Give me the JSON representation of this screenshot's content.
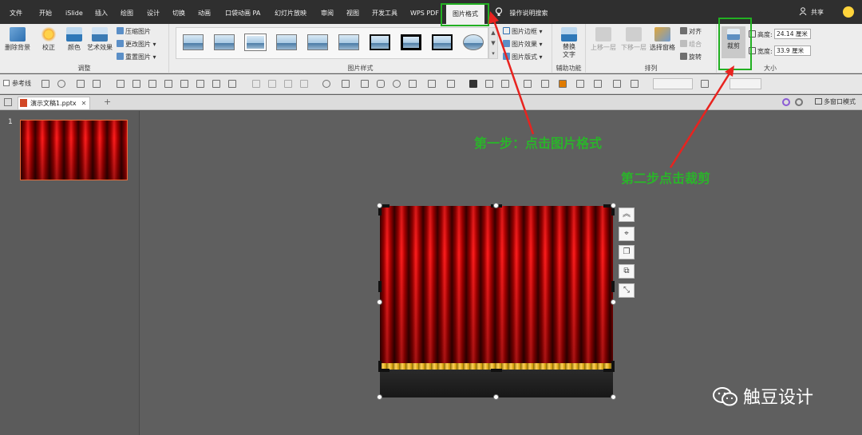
{
  "ribbon_tabs": {
    "file": "文件",
    "home": "开始",
    "islide": "iSlide",
    "insert": "插入",
    "draw": "绘图",
    "design": "设计",
    "transitions": "切换",
    "animations": "动画",
    "pocket_anim": "口袋动画 PA",
    "slideshow": "幻灯片放映",
    "review": "审阅",
    "view": "视图",
    "developer": "开发工具",
    "wps_pdf": "WPS PDF",
    "picture_format": "图片格式"
  },
  "tell_me": "操作说明搜索",
  "share": "共享",
  "ribbon": {
    "adjust": {
      "remove_bg": "删除背景",
      "corrections": "校正",
      "color": "颜色",
      "artistic": "艺术效果",
      "compress": "压缩图片",
      "change": "更改图片",
      "reset": "重置图片",
      "label": "调整"
    },
    "styles": {
      "label": "图片样式",
      "border": "图片边框",
      "effects": "图片效果",
      "layout": "图片版式"
    },
    "accessibility": {
      "alt_text": "替换文字",
      "label": "辅助功能"
    },
    "arrange": {
      "bring_forward": "上移一层",
      "send_backward": "下移一层",
      "selection_pane": "选择窗格",
      "align": "对齐",
      "group": "组合",
      "rotate": "旋转",
      "label": "排列"
    },
    "size": {
      "crop": "裁剪",
      "height_label": "高度:",
      "height_value": "24.14 厘米",
      "width_label": "宽度:",
      "width_value": "33.9 厘米",
      "label": "大小"
    }
  },
  "qat": {
    "guides": "参考线"
  },
  "document": {
    "tab_name": "演示文稿1.pptx",
    "multi_window": "多窗口模式"
  },
  "slides": {
    "number": "1"
  },
  "annotations": {
    "step1": "第一步：点击图片格式",
    "step2": "第二步点击裁剪"
  },
  "watermark": "触豆设计",
  "colors": {
    "annotation_green": "#2bb32b",
    "arrow_red": "#e8231f",
    "curtain_red": "#e40000",
    "thumb_border": "#e86c3a"
  }
}
